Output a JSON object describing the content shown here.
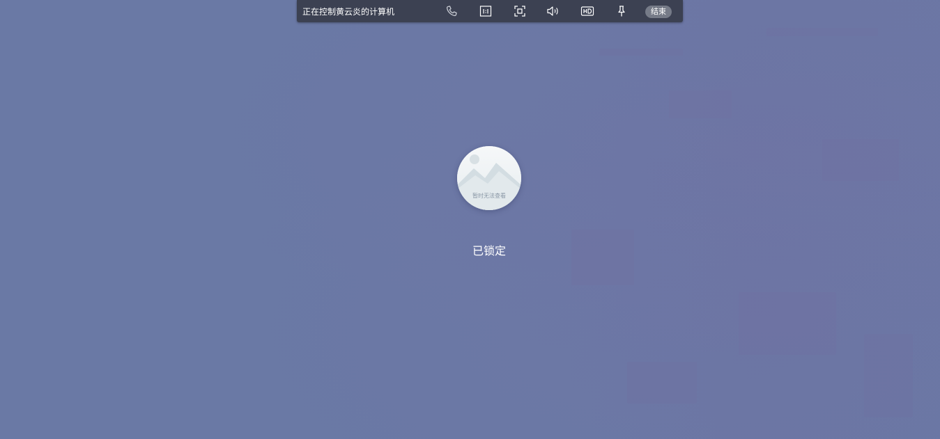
{
  "toolbar": {
    "title": "正在控制黄云炎的计算机",
    "icons": [
      "phone-icon",
      "actual-size-icon",
      "fullscreen-icon",
      "speaker-icon",
      "hd-icon",
      "pin-icon"
    ],
    "end_label": "结束",
    "background_color": "#3c4152"
  },
  "lock_screen": {
    "avatar_caption": "暂时无法查看",
    "status": "已锁定",
    "background_color": "#6a79a5"
  }
}
